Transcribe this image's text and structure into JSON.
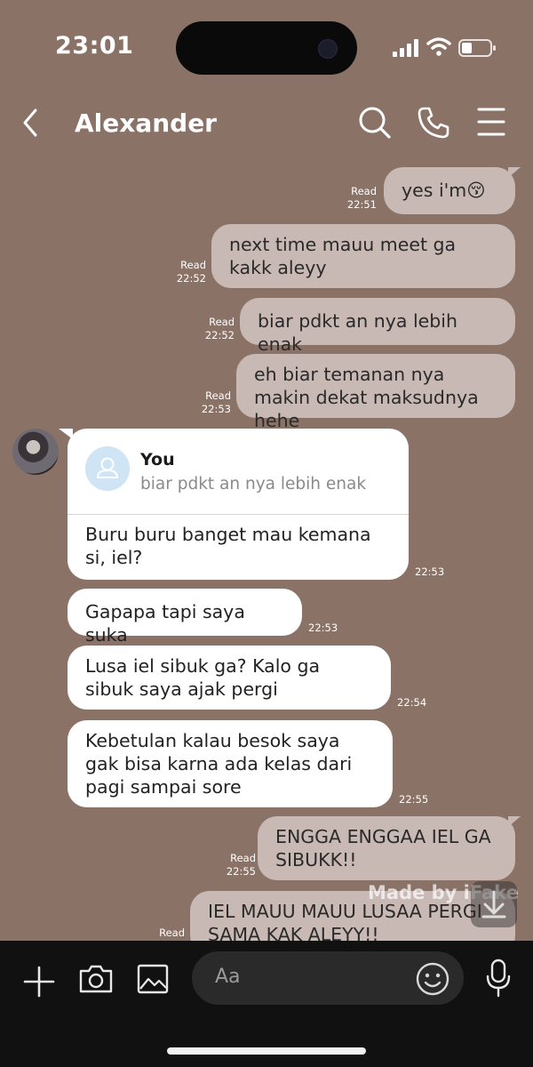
{
  "status_bar": {
    "time": "23:01"
  },
  "header": {
    "contact_name": "Alexander"
  },
  "messages": [
    {
      "text": "yes i'm😚",
      "read": "Read",
      "time": "22:51"
    },
    {
      "text": "next time mauu meet ga kakk aleyy",
      "read": "Read",
      "time": "22:52"
    },
    {
      "text": "biar pdkt an nya lebih enak",
      "read": "Read",
      "time": "22:52"
    },
    {
      "text": "eh biar temanan nya makin dekat maksudnya hehe",
      "read": "Read",
      "time": "22:53"
    },
    {
      "quote_name": "You",
      "quote_text": "biar pdkt an nya lebih enak",
      "text": "Buru buru banget mau kemana si, iel?",
      "time": "22:53"
    },
    {
      "text": "Gapapa tapi saya suka",
      "time": "22:53"
    },
    {
      "text": "Lusa iel sibuk ga? Kalo ga sibuk saya ajak pergi",
      "time": "22:54"
    },
    {
      "text": "Kebetulan kalau besok saya gak bisa karna ada kelas dari pagi sampai sore",
      "time": "22:55"
    },
    {
      "text": "ENGGA ENGGAA IEL GA SIBUKK!!",
      "read": "Read",
      "time": "22:55"
    },
    {
      "text": "IEL MAUU MAUU LUSAA PERGI SAMA KAK ALEYY!!",
      "read": "Read"
    }
  ],
  "watermark": "Made by iFake",
  "input": {
    "placeholder": "Aa"
  },
  "colors": {
    "background": "#8b7266",
    "outgoing_bubble": "#c9b9b4",
    "incoming_bubble": "#ffffff",
    "input_bar": "#111111"
  },
  "icons": [
    "back-chevron-icon",
    "search-icon",
    "phone-icon",
    "menu-icon",
    "plus-icon",
    "camera-icon",
    "image-icon",
    "emoji-icon",
    "mic-icon",
    "scroll-down-icon"
  ]
}
